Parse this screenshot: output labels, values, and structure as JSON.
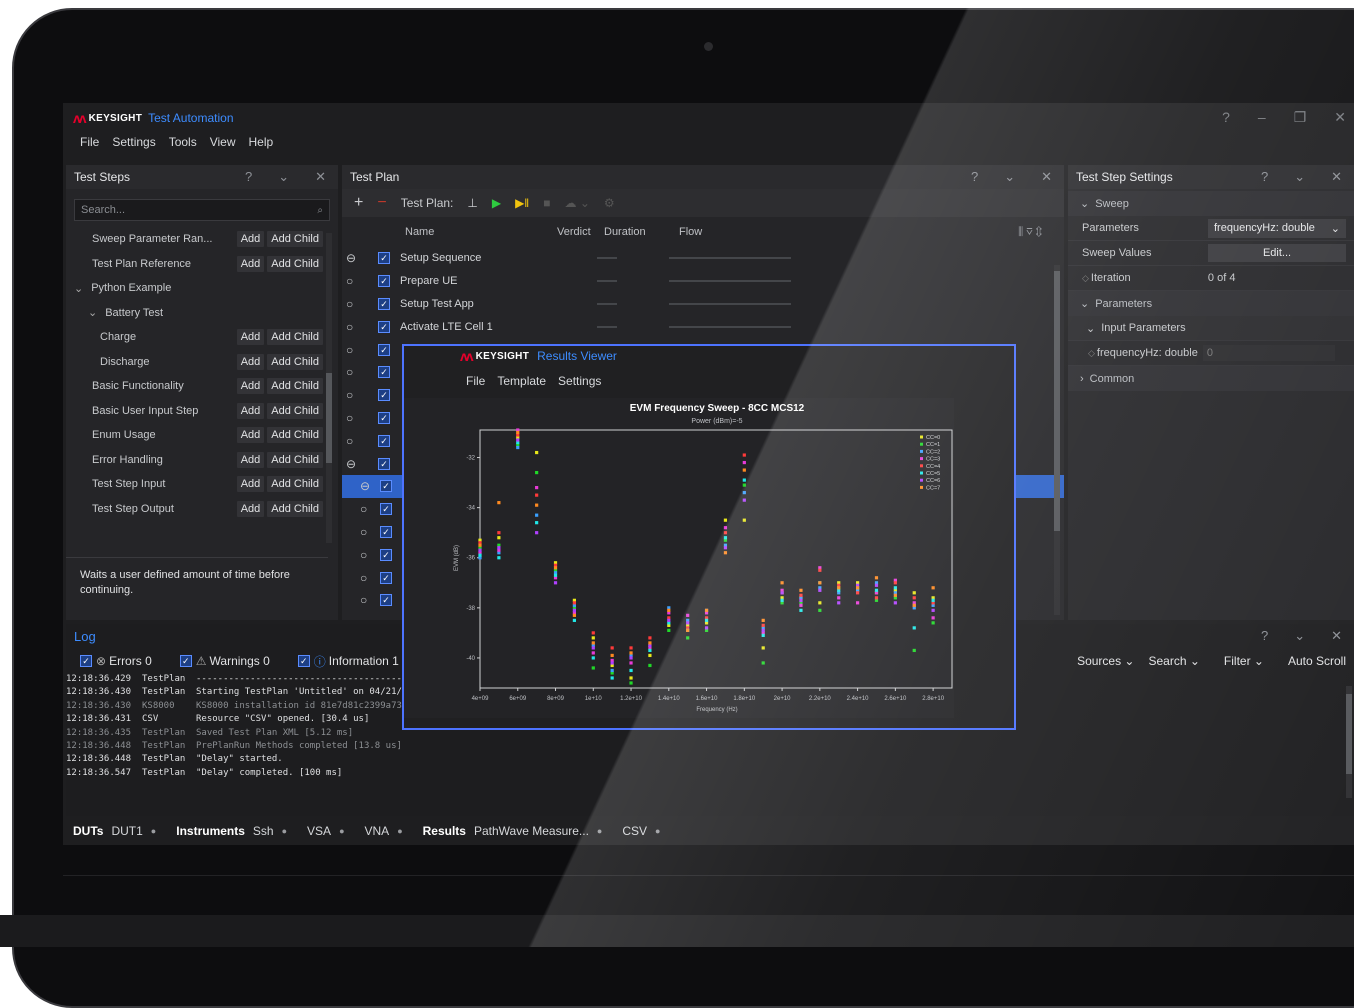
{
  "app": {
    "logo": "KEYSIGHT",
    "title": "Test Automation",
    "window_controls": [
      "?",
      "–",
      "❐",
      "✕"
    ]
  },
  "menu": [
    "File",
    "Settings",
    "Tools",
    "View",
    "Help"
  ],
  "test_steps": {
    "title": "Test Steps",
    "search_placeholder": "Search...",
    "add_label": "Add",
    "add_child_label": "Add Child",
    "items": [
      {
        "label": "Sweep Parameter Ran...",
        "indent": 2,
        "buttons": true
      },
      {
        "label": "Test Plan Reference",
        "indent": 2,
        "buttons": true
      },
      {
        "label": "Python Example",
        "indent": 0,
        "buttons": false,
        "expander": "⌄"
      },
      {
        "label": "Battery Test",
        "indent": 1,
        "buttons": false,
        "expander": "⌄"
      },
      {
        "label": "Charge",
        "indent": 3,
        "buttons": true
      },
      {
        "label": "Discharge",
        "indent": 3,
        "buttons": true
      },
      {
        "label": "Basic Functionality",
        "indent": 2,
        "buttons": true
      },
      {
        "label": "Basic User Input Step",
        "indent": 2,
        "buttons": true
      },
      {
        "label": "Enum Usage",
        "indent": 2,
        "buttons": true
      },
      {
        "label": "Error Handling",
        "indent": 2,
        "buttons": true
      },
      {
        "label": "Test Step Input",
        "indent": 2,
        "buttons": true
      },
      {
        "label": "Test Step Output",
        "indent": 2,
        "buttons": true
      }
    ],
    "description": "Waits a user defined amount of time before continuing."
  },
  "test_plan": {
    "title": "Test Plan",
    "toolbar_label": "Test Plan:",
    "columns": [
      "Name",
      "Verdict",
      "Duration",
      "Flow"
    ],
    "rows": [
      "Setup Sequence",
      "Prepare UE",
      "Setup Test App",
      "Activate LTE Cell 1",
      "",
      "",
      "",
      "",
      "",
      "",
      "",
      "",
      "",
      "",
      "",
      ""
    ],
    "selected_row": 10
  },
  "settings": {
    "title": "Test Step Settings",
    "sweep_section": "Sweep",
    "parameters_label": "Parameters",
    "parameters_value": "frequencyHz: double",
    "sweep_values_label": "Sweep Values",
    "sweep_values_button": "Edit...",
    "iteration_label": "Iteration",
    "iteration_value": "0 of 4",
    "parameters_section": "Parameters",
    "input_parameters": "Input Parameters",
    "freq_label": "frequencyHz: double",
    "freq_value": "0",
    "common_section": "Common"
  },
  "results_viewer": {
    "logo": "KEYSIGHT",
    "title": "Results Viewer",
    "menu": [
      "File",
      "Template",
      "Settings"
    ]
  },
  "chart_data": {
    "type": "scatter",
    "title": "EVM Frequency Sweep - 8CC MCS12",
    "subtitle": "Power (dBm)=-5",
    "xlabel": "Frequency (Hz)",
    "ylabel": "EVM (dB)",
    "xlim": [
      4000000000.0,
      29000000000.0
    ],
    "ylim": [
      -41.2,
      -30.9
    ],
    "x_tick_labels": [
      "4e+09",
      "6e+09",
      "8e+09",
      "1e+10",
      "1.2e+10",
      "1.4e+10",
      "1.6e+10",
      "1.8e+10",
      "2e+10",
      "2.2e+10",
      "2.4e+10",
      "2.6e+10",
      "2.8e+10"
    ],
    "x_ticks": [
      4000000000.0,
      6000000000.0,
      8000000000.0,
      10000000000.0,
      12000000000.0,
      14000000000.0,
      16000000000.0,
      18000000000.0,
      20000000000.0,
      22000000000.0,
      24000000000.0,
      26000000000.0,
      28000000000.0
    ],
    "y_ticks": [
      -32,
      -34,
      -36,
      -38,
      -40
    ],
    "legend_position": "top-right",
    "series": [
      {
        "name": "CC=0",
        "color": "#e8e81a",
        "x": [
          4000000000.0,
          5000000000.0,
          6000000000.0,
          7000000000.0,
          8000000000.0,
          9000000000.0,
          10000000000.0,
          11000000000.0,
          12000000000.0,
          13000000000.0,
          14000000000.0,
          15000000000.0,
          16000000000.0,
          17000000000.0,
          18000000000.0,
          19000000000.0,
          20000000000.0,
          21000000000.0,
          22000000000.0,
          23000000000.0,
          24000000000.0,
          25000000000.0,
          26000000000.0,
          27000000000.0,
          28000000000.0
        ],
        "y": [
          -35.3,
          -35.2,
          -31.2,
          -31.8,
          -36.2,
          -37.7,
          -39.2,
          -40.3,
          -40.8,
          -39.9,
          -38.7,
          -38.7,
          -38.6,
          -34.5,
          -34.5,
          -39.6,
          -37.6,
          -37.6,
          -37.8,
          -37.0,
          -37.0,
          -37.4,
          -37.3,
          -37.4,
          -37.6
        ]
      },
      {
        "name": "CC=1",
        "color": "#20d828",
        "x": [
          4000000000.0,
          5000000000.0,
          6000000000.0,
          7000000000.0,
          8000000000.0,
          9000000000.0,
          10000000000.0,
          11000000000.0,
          12000000000.0,
          13000000000.0,
          14000000000.0,
          15000000000.0,
          16000000000.0,
          17000000000.0,
          18000000000.0,
          19000000000.0,
          20000000000.0,
          21000000000.0,
          22000000000.0,
          23000000000.0,
          24000000000.0,
          25000000000.0,
          26000000000.0,
          27000000000.0,
          28000000000.0
        ],
        "y": [
          -35.6,
          -35.5,
          -31.5,
          -32.6,
          -36.5,
          -38.0,
          -40.4,
          -40.6,
          -41.0,
          -40.3,
          -38.9,
          -39.2,
          -38.9,
          -35.3,
          -33.1,
          -40.2,
          -37.8,
          -37.8,
          -38.1,
          -37.2,
          -37.3,
          -37.7,
          -37.6,
          -39.7,
          -38.6
        ]
      },
      {
        "name": "CC=2",
        "color": "#3aa0ff",
        "x": [
          4000000000.0,
          5000000000.0,
          6000000000.0,
          7000000000.0,
          8000000000.0,
          9000000000.0,
          10000000000.0,
          11000000000.0,
          12000000000.0,
          13000000000.0,
          14000000000.0,
          15000000000.0,
          16000000000.0,
          17000000000.0,
          18000000000.0,
          19000000000.0,
          20000000000.0,
          21000000000.0,
          22000000000.0,
          23000000000.0,
          24000000000.0,
          25000000000.0,
          26000000000.0,
          27000000000.0,
          28000000000.0
        ],
        "y": [
          -36.0,
          -35.8,
          -31.6,
          -34.3,
          -36.6,
          -37.9,
          -39.5,
          -40.5,
          -39.9,
          -39.5,
          -38.0,
          -38.5,
          -38.1,
          -35.5,
          -33.4,
          -38.8,
          -37.4,
          -37.6,
          -37.2,
          -37.4,
          -37.3,
          -37.0,
          -37.4,
          -38.0,
          -37.9
        ]
      },
      {
        "name": "CC=3",
        "color": "#e83ad8",
        "x": [
          4000000000.0,
          5000000000.0,
          6000000000.0,
          7000000000.0,
          8000000000.0,
          9000000000.0,
          10000000000.0,
          11000000000.0,
          12000000000.0,
          13000000000.0,
          14000000000.0,
          15000000000.0,
          16000000000.0,
          17000000000.0,
          18000000000.0,
          19000000000.0,
          20000000000.0,
          21000000000.0,
          22000000000.0,
          23000000000.0,
          24000000000.0,
          25000000000.0,
          26000000000.0,
          27000000000.0,
          28000000000.0
        ],
        "y": [
          -35.8,
          -35.7,
          -30.9,
          -33.2,
          -36.8,
          -38.2,
          -39.8,
          -40.1,
          -40.2,
          -39.6,
          -38.2,
          -38.3,
          -38.2,
          -34.8,
          -32.2,
          -39.0,
          -37.3,
          -37.9,
          -36.4,
          -37.6,
          -37.8,
          -37.4,
          -36.9,
          -37.8,
          -38.4
        ]
      },
      {
        "name": "CC=4",
        "color": "#ff3a3a",
        "x": [
          4000000000.0,
          5000000000.0,
          6000000000.0,
          7000000000.0,
          8000000000.0,
          9000000000.0,
          10000000000.0,
          11000000000.0,
          12000000000.0,
          13000000000.0,
          14000000000.0,
          15000000000.0,
          16000000000.0,
          17000000000.0,
          18000000000.0,
          19000000000.0,
          20000000000.0,
          21000000000.0,
          22000000000.0,
          23000000000.0,
          24000000000.0,
          25000000000.0,
          26000000000.0,
          27000000000.0,
          28000000000.0
        ],
        "y": [
          -35.4,
          -35.0,
          -31.1,
          -33.5,
          -36.3,
          -37.8,
          -39.0,
          -39.6,
          -39.6,
          -39.2,
          -38.4,
          -38.8,
          -38.4,
          -35.0,
          -31.9,
          -38.7,
          -37.4,
          -37.5,
          -36.5,
          -37.1,
          -37.4,
          -37.6,
          -37.0,
          -37.6,
          -37.8
        ]
      },
      {
        "name": "CC=5",
        "color": "#20e8e8",
        "x": [
          4000000000.0,
          5000000000.0,
          6000000000.0,
          7000000000.0,
          8000000000.0,
          9000000000.0,
          10000000000.0,
          11000000000.0,
          12000000000.0,
          13000000000.0,
          14000000000.0,
          15000000000.0,
          16000000000.0,
          17000000000.0,
          18000000000.0,
          19000000000.0,
          20000000000.0,
          21000000000.0,
          22000000000.0,
          23000000000.0,
          24000000000.0,
          25000000000.0,
          26000000000.0,
          27000000000.0,
          28000000000.0
        ],
        "y": [
          -35.9,
          -36.0,
          -31.4,
          -34.6,
          -36.7,
          -38.5,
          -40.0,
          -40.8,
          -40.5,
          -39.7,
          -38.6,
          -38.9,
          -38.5,
          -35.2,
          -32.9,
          -39.1,
          -37.7,
          -38.1,
          -37.0,
          -37.3,
          -37.2,
          -37.3,
          -37.2,
          -38.8,
          -37.7
        ]
      },
      {
        "name": "CC=6",
        "color": "#b040ff",
        "x": [
          4000000000.0,
          5000000000.0,
          6000000000.0,
          7000000000.0,
          8000000000.0,
          9000000000.0,
          10000000000.0,
          11000000000.0,
          12000000000.0,
          13000000000.0,
          14000000000.0,
          15000000000.0,
          16000000000.0,
          17000000000.0,
          18000000000.0,
          19000000000.0,
          20000000000.0,
          21000000000.0,
          22000000000.0,
          23000000000.0,
          24000000000.0,
          25000000000.0,
          26000000000.0,
          27000000000.0,
          28000000000.0
        ],
        "y": [
          -35.7,
          -35.6,
          -31.3,
          -35.0,
          -37.0,
          -38.1,
          -39.6,
          -40.2,
          -40.0,
          -39.5,
          -38.5,
          -38.6,
          -38.8,
          -35.6,
          -33.7,
          -38.9,
          -37.4,
          -37.7,
          -37.3,
          -37.8,
          -37.1,
          -37.1,
          -37.8,
          -37.9,
          -38.1
        ]
      },
      {
        "name": "CC=7",
        "color": "#ff8a20",
        "x": [
          4000000000.0,
          5000000000.0,
          6000000000.0,
          7000000000.0,
          8000000000.0,
          9000000000.0,
          10000000000.0,
          11000000000.0,
          12000000000.0,
          13000000000.0,
          14000000000.0,
          15000000000.0,
          16000000000.0,
          17000000000.0,
          18000000000.0,
          19000000000.0,
          20000000000.0,
          21000000000.0,
          22000000000.0,
          23000000000.0,
          24000000000.0,
          25000000000.0,
          26000000000.0,
          27000000000.0,
          28000000000.0
        ],
        "y": [
          -35.5,
          -33.8,
          -31.0,
          -33.9,
          -36.4,
          -38.3,
          -39.4,
          -39.9,
          -39.8,
          -39.4,
          -38.1,
          -38.9,
          -38.1,
          -35.8,
          -32.5,
          -38.5,
          -37.0,
          -37.3,
          -37.0,
          -37.2,
          -37.2,
          -36.8,
          -37.5,
          -37.9,
          -37.2
        ]
      }
    ]
  },
  "log": {
    "title": "Log",
    "errors": "Errors 0",
    "warnings": "Warnings 0",
    "information": "Information 1",
    "sources": "Sources",
    "search": "Search",
    "filter": "Filter",
    "autoscroll": "Auto Scroll",
    "lines": [
      {
        "time": "12:18:36.429",
        "source": "TestPlan",
        "msg": "-------------------------------------------",
        "dim": false
      },
      {
        "time": "12:18:36.430",
        "source": "TestPlan",
        "msg": "Starting TestPlan 'Untitled' on 04/21/",
        "dim": false
      },
      {
        "time": "12:18:36.430",
        "source": "KS8000",
        "msg": "KS8000 installation id 81e7d81c2399a73",
        "dim": true
      },
      {
        "time": "12:18:36.431",
        "source": "CSV",
        "msg": "Resource \"CSV\" opened. [30.4 us]",
        "dim": false
      },
      {
        "time": "12:18:36.435",
        "source": "TestPlan",
        "msg": "Saved Test Plan XML [5.12 ms]",
        "dim": true
      },
      {
        "time": "12:18:36.448",
        "source": "TestPlan",
        "msg": "PrePlanRun Methods completed [13.8 us]",
        "dim": true
      },
      {
        "time": "12:18:36.448",
        "source": "TestPlan",
        "msg": "\"Delay\" started.",
        "dim": false
      },
      {
        "time": "12:18:36.547",
        "source": "TestPlan",
        "msg": "\"Delay\" completed. [100 ms]",
        "dim": false
      }
    ]
  },
  "statusbar": {
    "duts_label": "DUTs",
    "dut1": "DUT1",
    "instruments_label": "Instruments",
    "ssh": "Ssh",
    "vsa": "VSA",
    "vna": "VNA",
    "results_label": "Results",
    "pathwave": "PathWave Measure...",
    "csv": "CSV"
  }
}
